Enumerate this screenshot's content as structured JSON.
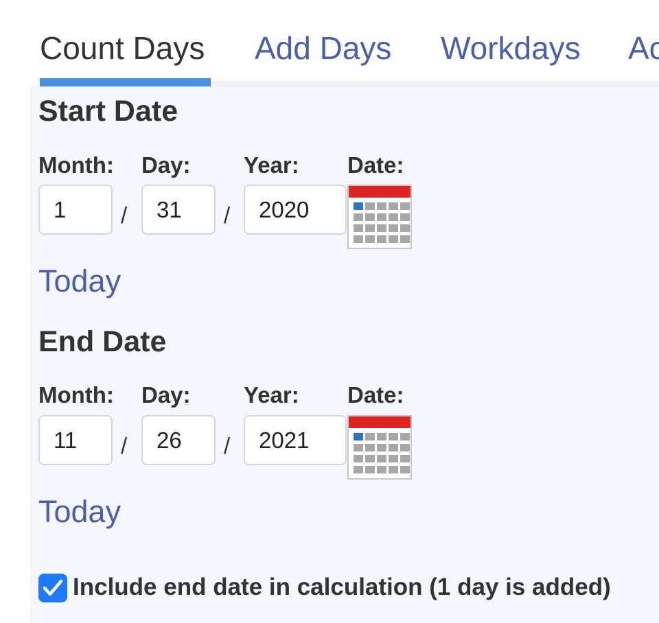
{
  "tabs": [
    {
      "label": "Count Days",
      "active": true
    },
    {
      "label": "Add Days",
      "active": false
    },
    {
      "label": "Workdays",
      "active": false
    },
    {
      "label": "Ac",
      "active": false
    }
  ],
  "start": {
    "title": "Start Date",
    "labels": {
      "month": "Month:",
      "day": "Day:",
      "year": "Year:",
      "date": "Date:"
    },
    "month": "1",
    "day": "31",
    "year": "2020",
    "separator": "/",
    "today_link": "Today",
    "calendar_icon": "calendar-icon"
  },
  "end": {
    "title": "End Date",
    "labels": {
      "month": "Month:",
      "day": "Day:",
      "year": "Year:",
      "date": "Date:"
    },
    "month": "11",
    "day": "26",
    "year": "2021",
    "separator": "/",
    "today_link": "Today",
    "calendar_icon": "calendar-icon"
  },
  "include_end": {
    "checked": true,
    "label": "Include end date in calculation (1 day is added)",
    "icon": "checkmark-icon"
  },
  "colors": {
    "accent": "#4a90e2",
    "link": "#4a5fa8",
    "checkbox": "#1e7bf5",
    "calendar_header": "#e02424"
  }
}
